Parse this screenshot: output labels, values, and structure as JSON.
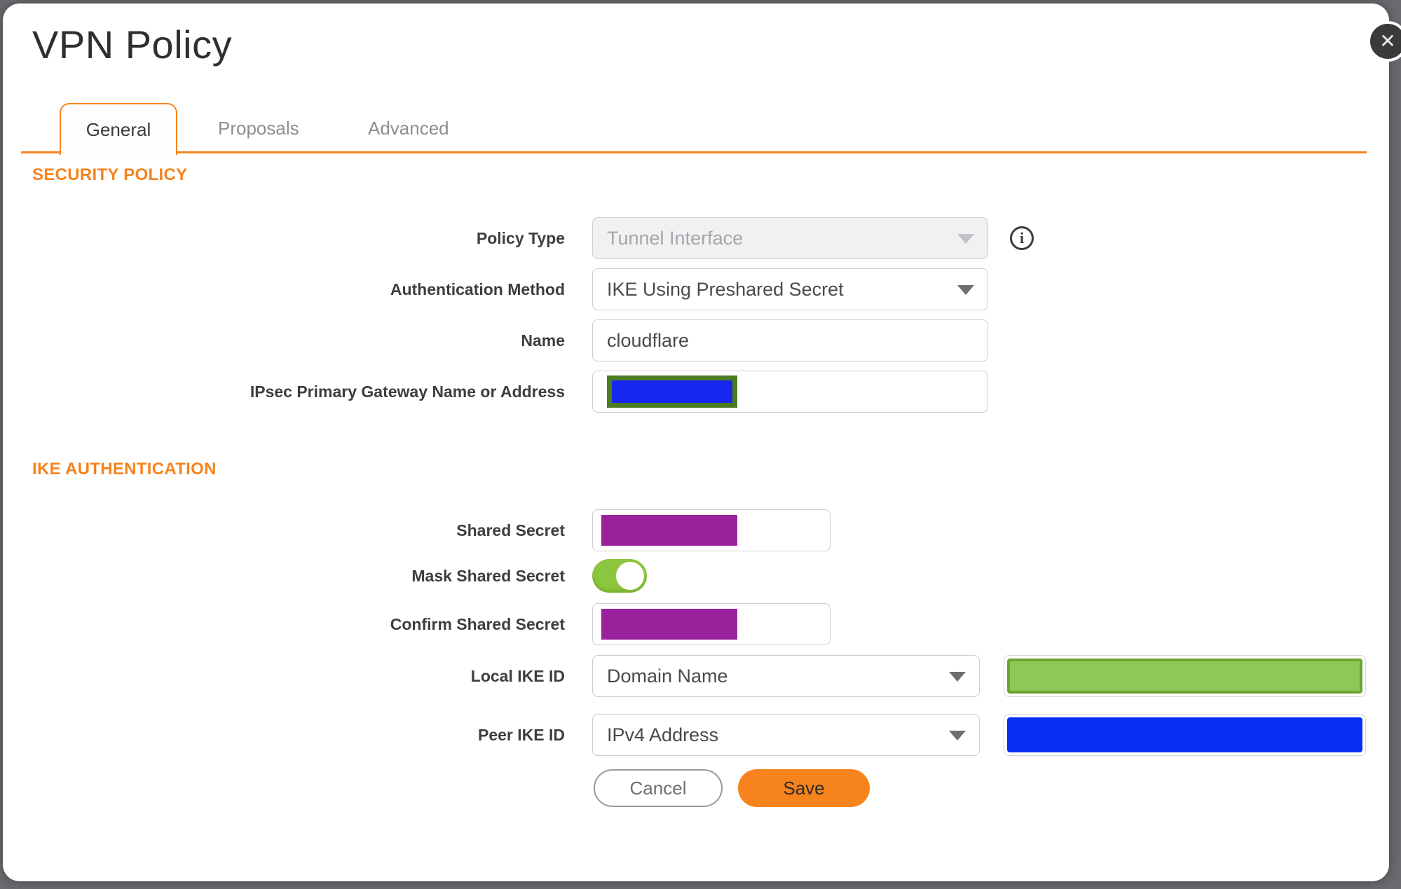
{
  "window": {
    "title": "VPN Policy"
  },
  "icons": {
    "close": "✕",
    "info": "i"
  },
  "tabs": [
    {
      "label": "General",
      "active": true
    },
    {
      "label": "Proposals",
      "active": false
    },
    {
      "label": "Advanced",
      "active": false
    }
  ],
  "security_policy": {
    "heading": "SECURITY POLICY",
    "policy_type": {
      "label": "Policy Type",
      "value": "Tunnel Interface",
      "disabled": true
    },
    "authentication_method": {
      "label": "Authentication Method",
      "value": "IKE Using Preshared Secret"
    },
    "name": {
      "label": "Name",
      "value": "cloudflare"
    },
    "gateway": {
      "label": "IPsec Primary Gateway Name or Address",
      "value": "",
      "masked": true
    }
  },
  "ike_authentication": {
    "heading": "IKE AUTHENTICATION",
    "shared_secret": {
      "label": "Shared Secret",
      "value": "",
      "masked": true
    },
    "mask_shared_secret": {
      "label": "Mask Shared Secret",
      "state": "on"
    },
    "confirm_shared_secret": {
      "label": "Confirm Shared Secret",
      "value": "",
      "masked": true
    },
    "local_ike_id": {
      "label": "Local IKE ID",
      "value": "Domain Name",
      "id_value_masked": true
    },
    "peer_ike_id": {
      "label": "Peer IKE ID",
      "value": "IPv4 Address",
      "id_value_masked": true
    }
  },
  "buttons": {
    "cancel": "Cancel",
    "save": "Save"
  },
  "colors": {
    "accent_orange": "#F7831D",
    "background_gray": "#6A6A6E",
    "toggle_green": "#8CC63F",
    "redaction_purple": "#9A239D",
    "redaction_blue_peer": "#0B2FF2",
    "redaction_blue_gateway": "#1727EE",
    "redaction_olive_border": "#4C7B22",
    "redaction_green_fill": "#90C857",
    "redaction_green_border": "#6CA434"
  }
}
